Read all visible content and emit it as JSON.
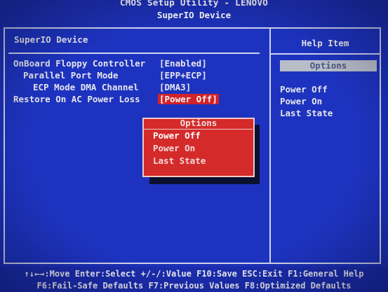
{
  "header": {
    "title": "CMOS Setup Utility - LENOVO",
    "subtitle": "SuperIO Device"
  },
  "section_title": "SuperIO Device",
  "settings": [
    {
      "label": "OnBoard Floppy Controller",
      "value": "[Enabled]"
    },
    {
      "label": "Parallel Port Mode",
      "value": "[EPP+ECP]"
    },
    {
      "label": "ECP Mode DMA Channel",
      "value": "[DMA3]"
    },
    {
      "label": "Restore On AC Power Loss",
      "value": "[Power Off]"
    }
  ],
  "help": {
    "title": "Help Item",
    "options_label": "Options",
    "options": [
      "Power Off",
      "Power On",
      "Last State"
    ]
  },
  "popup": {
    "title": "Options",
    "options": [
      "Power Off",
      "Power On",
      "Last State"
    ],
    "selected": "Power Off"
  },
  "footer": {
    "line1": "↑↓←→:Move  Enter:Select  +/-/:Value  F10:Save  ESC:Exit  F1:General Help",
    "line2": "F6:Fail-Safe Defaults   F7:Previous Values   F8:Optimized Defaults"
  },
  "colors": {
    "background": "#1c30b8",
    "highlight": "#d3222a",
    "popup": "#d52a2a",
    "text": "#e6e6ec"
  }
}
